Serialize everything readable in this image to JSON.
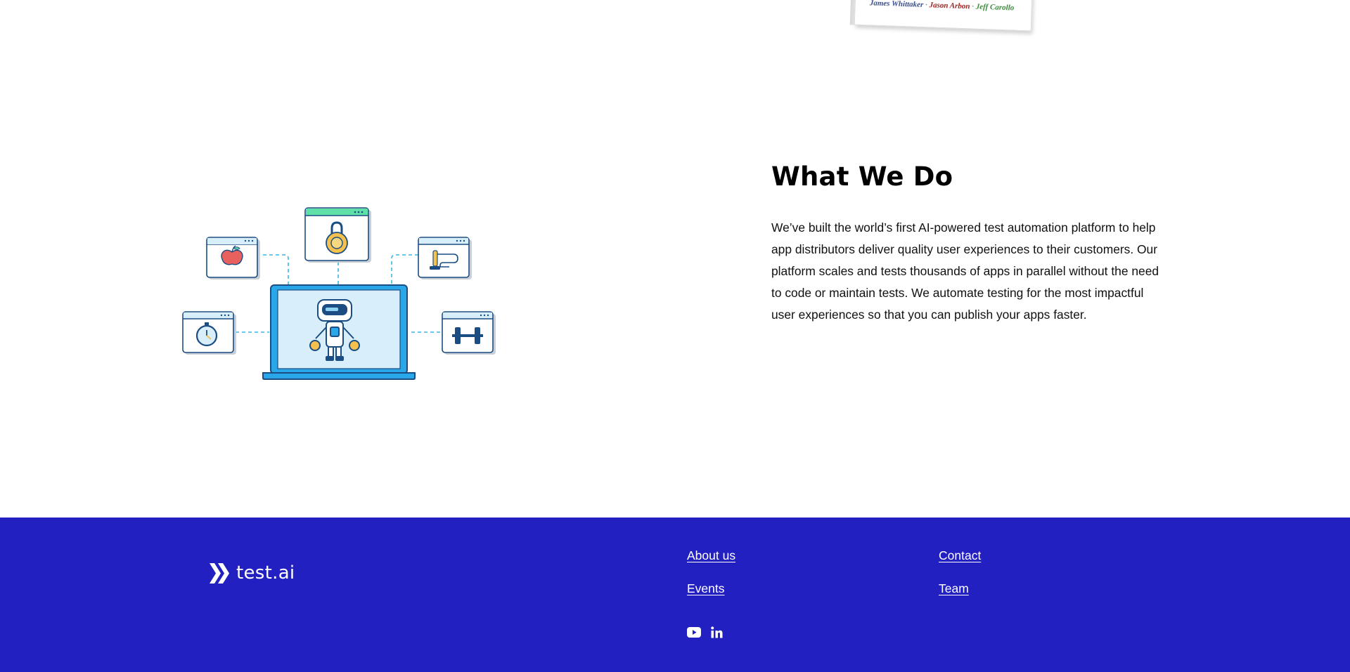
{
  "book": {
    "author1": "James Whittaker",
    "author2": "Jason Arbon",
    "author3": "Jeff Carollo",
    "separator": "·"
  },
  "section": {
    "heading": "What We Do",
    "body": "We’ve built the world’s first AI-powered test automation platform to help app distributors deliver quality user experiences to their customers. Our platform scales and tests thousands of apps in parallel without the need to code or maintain tests. We automate testing for the most impactful user experiences so that you can publish your apps faster."
  },
  "footer": {
    "logo_text": "test.ai",
    "links": {
      "about": "About us",
      "events": "Events",
      "contact": "Contact",
      "team": "Team"
    },
    "social": [
      "youtube-icon",
      "linkedin-icon"
    ]
  },
  "colors": {
    "footer_bg": "#2320c2",
    "accent_blue": "#2aa7e8",
    "accent_green": "#5fe0a8",
    "accent_yellow": "#f4c04e",
    "accent_red": "#e8615f"
  }
}
